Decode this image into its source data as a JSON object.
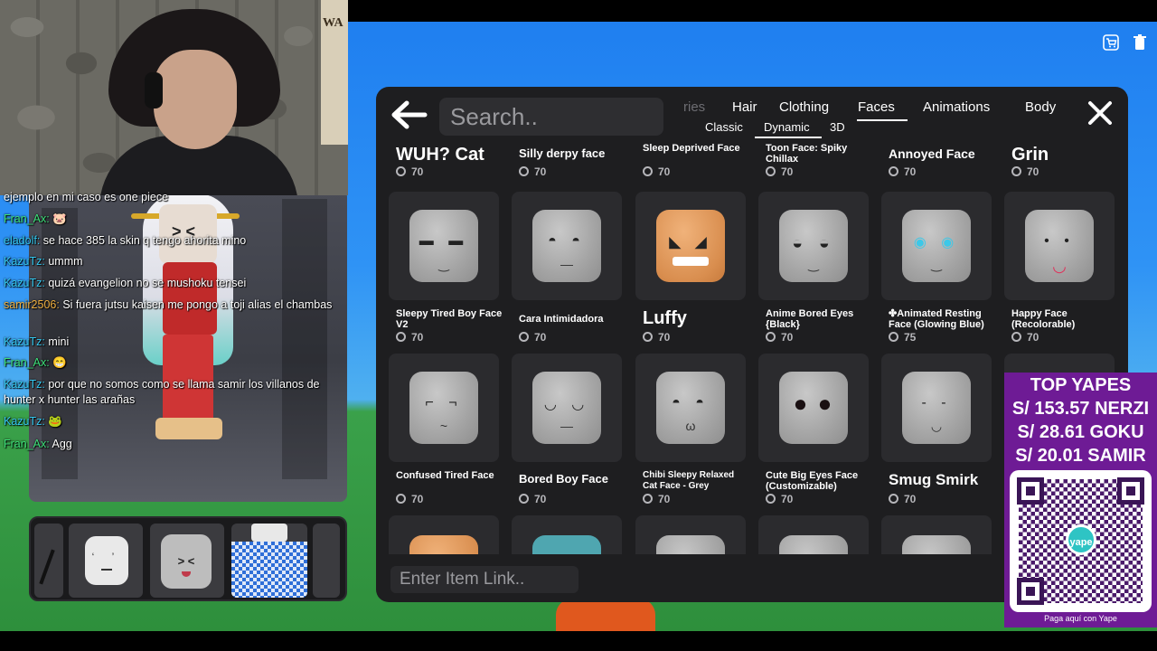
{
  "webcam": {
    "poster_text": "WA"
  },
  "chat": [
    {
      "user": "",
      "text": "ejemplo en mi caso es one piece"
    },
    {
      "user": "Fran_Ax:",
      "text": "🐷"
    },
    {
      "user": "eladolf:",
      "text": "se hace 385 la skin q tengo ahorita mino"
    },
    {
      "user": "KazuTz:",
      "text": "ummm"
    },
    {
      "user": "KazuTz:",
      "text": "quizá evangelion no se mushoku tensei"
    },
    {
      "user": "samir2506:",
      "text": "Si fuera jutsu kaisen me pongo a toji alias el chambas"
    },
    {
      "user": "KazuTz:",
      "text": "mini"
    },
    {
      "user": "Fran_Ax:",
      "text": "😁"
    },
    {
      "user": "KazuTz:",
      "text": "por que no somos como se llama samir los villanos de hunter x hunter las arañas"
    },
    {
      "user": "KazuTz:",
      "text": "🐸"
    },
    {
      "user": "Fran_Ax:",
      "text": "Agg"
    }
  ],
  "catalog": {
    "back_icon": "arrow-left-icon",
    "search_placeholder": "Search..",
    "tabs": [
      "ries",
      "Hair",
      "Clothing",
      "Faces",
      "Animations",
      "Body"
    ],
    "active_tab": "Faces",
    "subtabs": [
      "Classic",
      "Dynamic",
      "3D"
    ],
    "active_subtab": "Dynamic",
    "close_icon": "close-icon",
    "top_row": [
      {
        "name": "WUH? Cat",
        "price": "70"
      },
      {
        "name": "Silly derpy face",
        "price": "70"
      },
      {
        "name": "Sleep Deprived Face",
        "price": "70"
      },
      {
        "name": "Toon Face: Spiky Chillax",
        "price": "70"
      },
      {
        "name": "Annoyed Face",
        "price": "70"
      },
      {
        "name": "Grin",
        "price": "70"
      }
    ],
    "row1": [
      {
        "name": "Sleepy Tired Boy Face V2",
        "price": "70"
      },
      {
        "name": "Cara Intimidadora",
        "price": "70"
      },
      {
        "name": "Luffy",
        "price": "70"
      },
      {
        "name": "Anime Bored Eyes {Black}",
        "price": "70"
      },
      {
        "name": "✤Animated Resting Face (Glowing Blue)",
        "price": "75"
      },
      {
        "name": "Happy Face (Recolorable)",
        "price": "70"
      }
    ],
    "row2": [
      {
        "name": "Confused Tired Face",
        "price": "70"
      },
      {
        "name": "Bored Boy Face",
        "price": "70"
      },
      {
        "name": "Chibi Sleepy Relaxed Cat Face - Grey",
        "price": "70"
      },
      {
        "name": "Cute Big Eyes Face (Customizable)",
        "price": "70"
      },
      {
        "name": "Smug Smirk",
        "price": "70"
      }
    ],
    "link_placeholder": "Enter Item Link.."
  },
  "donations": {
    "title": "TOP YAPES",
    "entries": [
      "S/ 153.57 NERZI",
      "S/ 28.61 GOKU",
      "S/ 20.01 SAMIR"
    ],
    "logo_text": "yape",
    "cta": "Paga aquí con Yape"
  },
  "colors": {
    "panel_bg": "#1e1e20",
    "card_bg": "#2b2b2e",
    "yape_purple": "#6e1b95",
    "chat_user_blue": "#35c8f0"
  }
}
